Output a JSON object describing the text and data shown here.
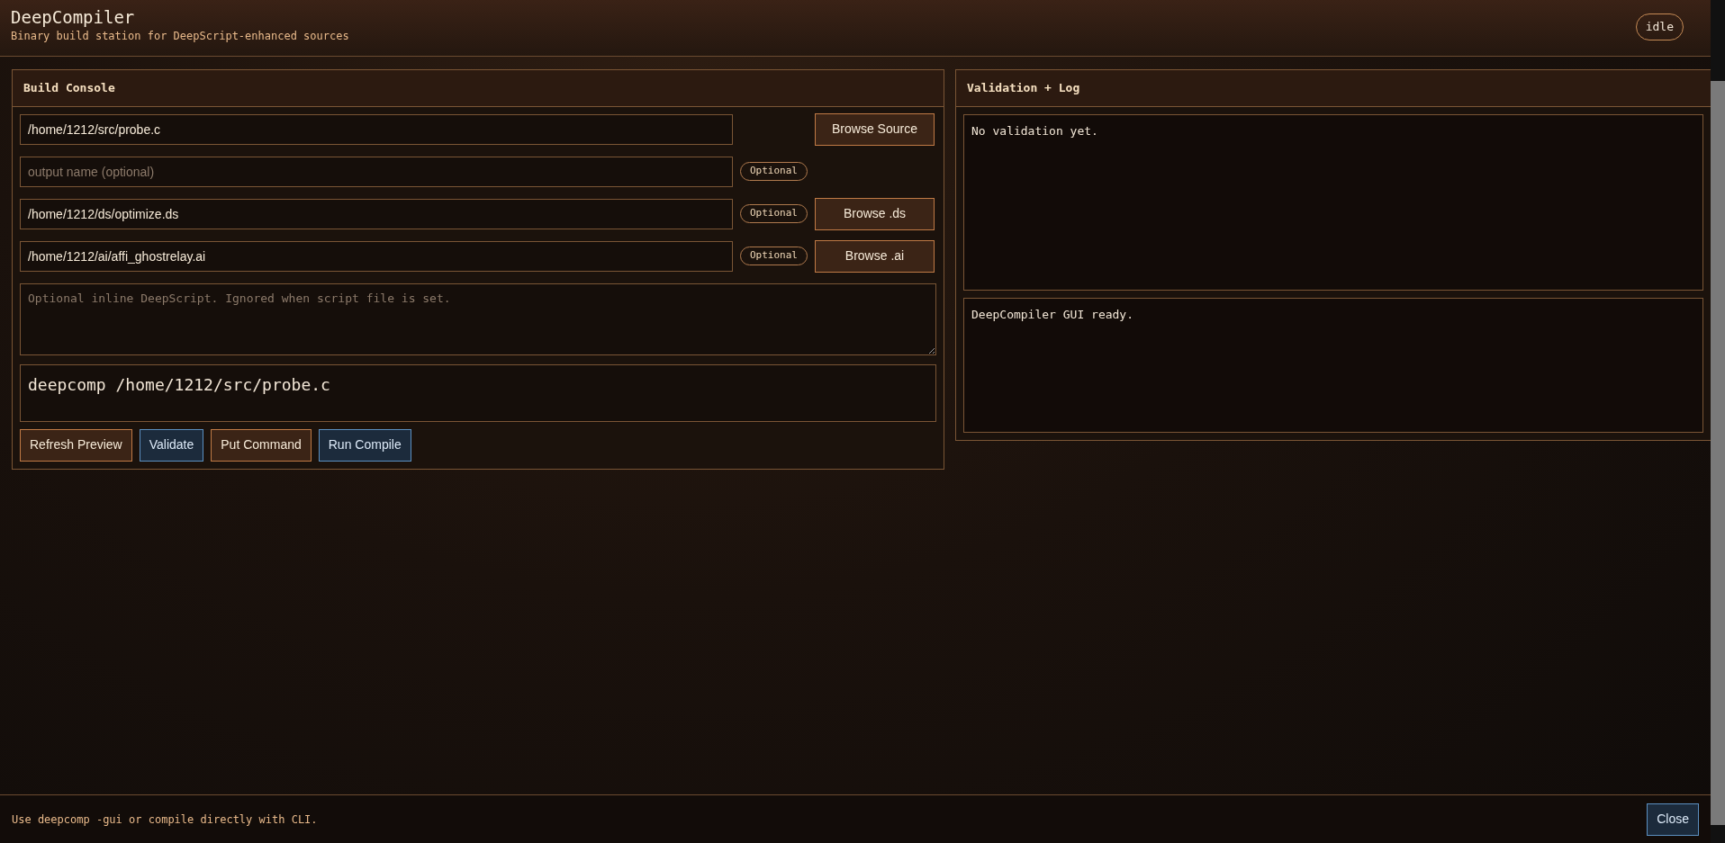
{
  "header": {
    "title": "DeepCompiler",
    "subtitle": "Binary build station for DeepScript-enhanced sources",
    "status": "idle"
  },
  "build_console": {
    "title": "Build Console",
    "fields": [
      {
        "value": "/home/1212/src/probe.c",
        "button": "Browse Source"
      },
      {
        "placeholder": "output name (optional)",
        "badge": "Optional"
      },
      {
        "value": "/home/1212/ds/optimize.ds",
        "badge": "Optional",
        "button": "Browse .ds"
      },
      {
        "value": "/home/1212/ai/affi_ghostrelay.ai",
        "badge": "Optional",
        "button": "Browse .ai"
      }
    ],
    "script": {
      "placeholder": "Optional inline DeepScript. Ignored when script file is set."
    },
    "command": "deepcomp /home/1212/src/probe.c",
    "actions": [
      {
        "label": "Refresh Preview",
        "kind": "secondary"
      },
      {
        "label": "Validate",
        "kind": "primary"
      },
      {
        "label": "Put Command",
        "kind": "secondary"
      },
      {
        "label": "Run Compile",
        "kind": "primary"
      }
    ]
  },
  "validation_log": {
    "title": "Validation + Log",
    "validation": "No validation yet.",
    "log": "DeepCompiler GUI ready."
  },
  "footer": {
    "hint": "Use deepcomp -gui or compile directly with CLI.",
    "close_button": {
      "label": "Close",
      "kind": "primary"
    }
  }
}
